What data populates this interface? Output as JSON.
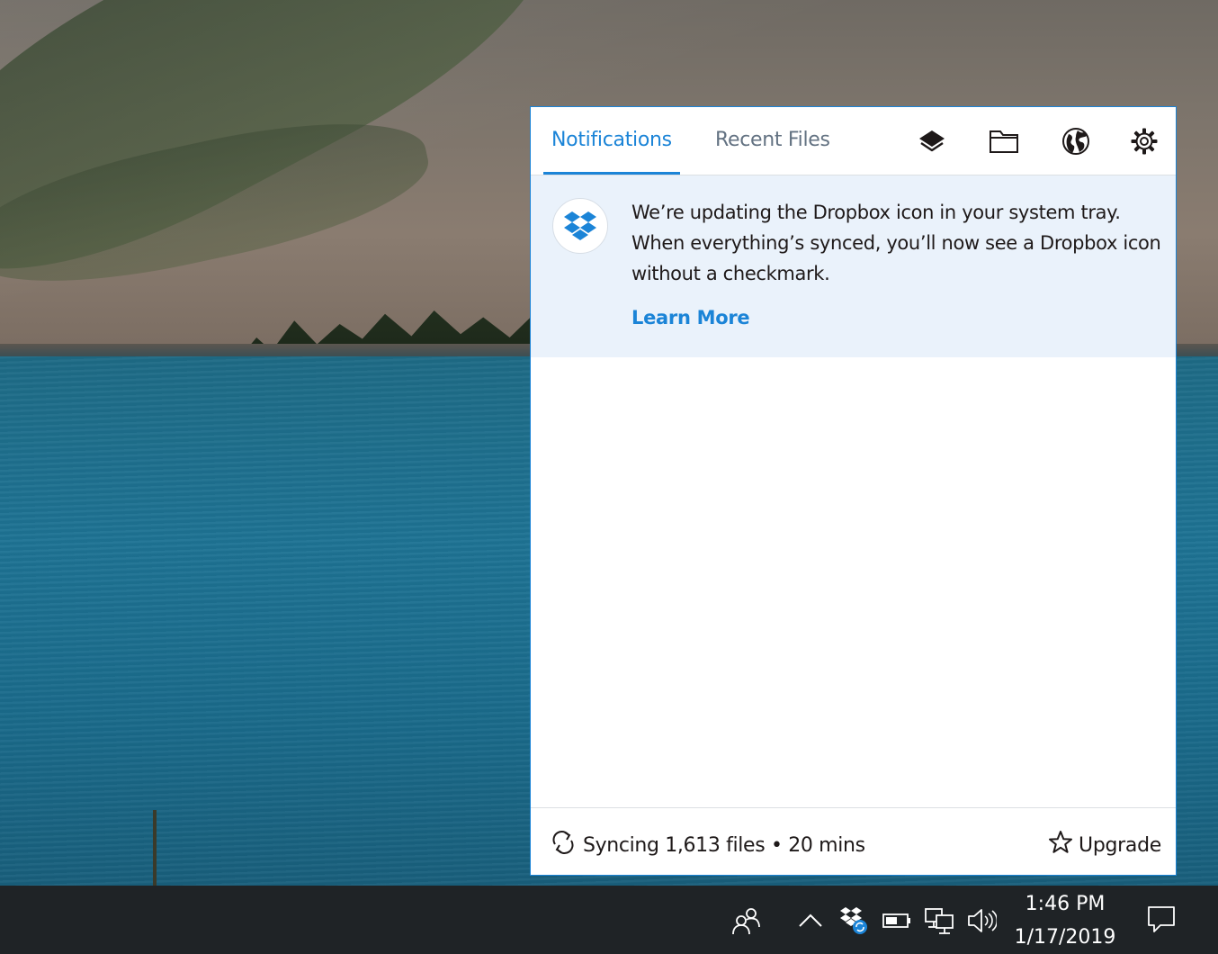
{
  "panel": {
    "tabs": [
      {
        "label": "Notifications",
        "active": true
      },
      {
        "label": "Recent Files",
        "active": false
      }
    ],
    "header_icons": [
      "dropbox-layers-icon",
      "folder-icon",
      "globe-icon",
      "gear-icon"
    ],
    "accent_color": "#1b84d7",
    "notification": {
      "icon": "dropbox-logo-icon",
      "message": "We’re updating the Dropbox icon in your system tray. When everything’s synced, you’ll now see a Dropbox icon without a checkmark.",
      "link_label": "Learn More",
      "background": "#eaf2fb"
    },
    "footer": {
      "status_icon": "sync-icon",
      "status_text": "Syncing 1,613 files • 20 mins",
      "upgrade_icon": "star-icon",
      "upgrade_label": "Upgrade"
    }
  },
  "taskbar": {
    "tray_icons": [
      "people-icon",
      "chevron-up-icon",
      "dropbox-tray-icon",
      "battery-icon",
      "network-icon",
      "volume-icon"
    ],
    "clock": {
      "time": "1:46 PM",
      "date": "1/17/2019"
    },
    "action_center_icon": "notification-bubble-icon"
  }
}
